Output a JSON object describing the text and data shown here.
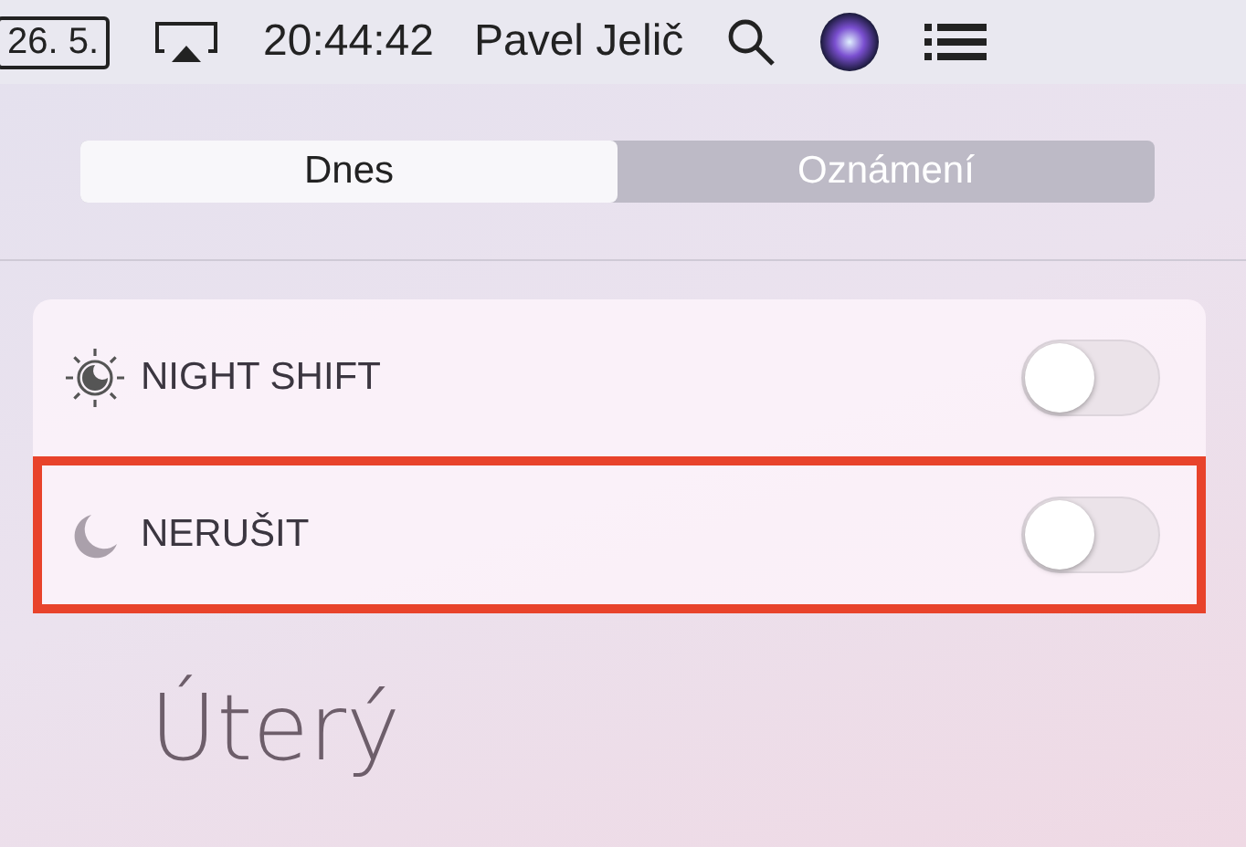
{
  "menu_bar": {
    "date": "26. 5.",
    "time": "20:44:42",
    "user": "Pavel Jelič"
  },
  "tabs": [
    {
      "label": "Dnes",
      "selected": true
    },
    {
      "label": "Oznámení",
      "selected": false
    }
  ],
  "toggles": [
    {
      "kind": "night-shift",
      "label": "NIGHT SHIFT",
      "on": false,
      "highlighted": false
    },
    {
      "kind": "do-not-disturb",
      "label": "NERUŠIT",
      "on": false,
      "highlighted": true
    }
  ],
  "day_heading": "Úterý"
}
